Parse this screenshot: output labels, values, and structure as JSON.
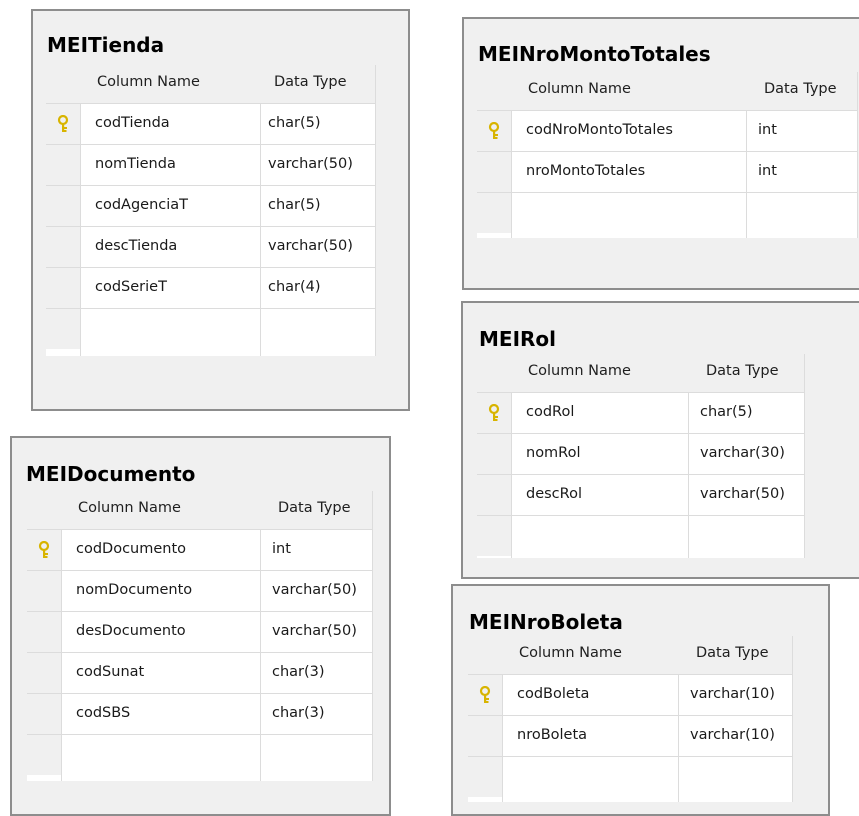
{
  "headers": {
    "col_name": "Column Name",
    "data_type": "Data Type"
  },
  "tables": {
    "tienda": {
      "title": "MEITienda",
      "rows": [
        {
          "name": "codTienda",
          "type": "char(5)",
          "pk": true
        },
        {
          "name": "nomTienda",
          "type": "varchar(50)",
          "pk": false
        },
        {
          "name": "codAgenciaT",
          "type": "char(5)",
          "pk": false
        },
        {
          "name": "descTienda",
          "type": "varchar(50)",
          "pk": false
        },
        {
          "name": "codSerieT",
          "type": "char(4)",
          "pk": false
        }
      ]
    },
    "nroMontoTotales": {
      "title": "MEINroMontoTotales",
      "rows": [
        {
          "name": "codNroMontoTotales",
          "type": "int",
          "pk": true
        },
        {
          "name": "nroMontoTotales",
          "type": "int",
          "pk": false
        }
      ]
    },
    "rol": {
      "title": "MEIRol",
      "rows": [
        {
          "name": "codRol",
          "type": "char(5)",
          "pk": true
        },
        {
          "name": "nomRol",
          "type": "varchar(30)",
          "pk": false
        },
        {
          "name": "descRol",
          "type": "varchar(50)",
          "pk": false
        }
      ]
    },
    "documento": {
      "title": "MEIDocumento",
      "rows": [
        {
          "name": "codDocumento",
          "type": "int",
          "pk": true
        },
        {
          "name": "nomDocumento",
          "type": "varchar(50)",
          "pk": false
        },
        {
          "name": "desDocumento",
          "type": "varchar(50)",
          "pk": false
        },
        {
          "name": "codSunat",
          "type": "char(3)",
          "pk": false
        },
        {
          "name": "codSBS",
          "type": "char(3)",
          "pk": false
        }
      ]
    },
    "nroBoleta": {
      "title": "MEINroBoleta",
      "rows": [
        {
          "name": "codBoleta",
          "type": "varchar(10)",
          "pk": true
        },
        {
          "name": "nroBoleta",
          "type": "varchar(10)",
          "pk": false
        }
      ]
    }
  },
  "colors": {
    "key_icon": "#d8b400",
    "panel_bg": "#f0f0f0",
    "border": "#8d8d8d"
  }
}
